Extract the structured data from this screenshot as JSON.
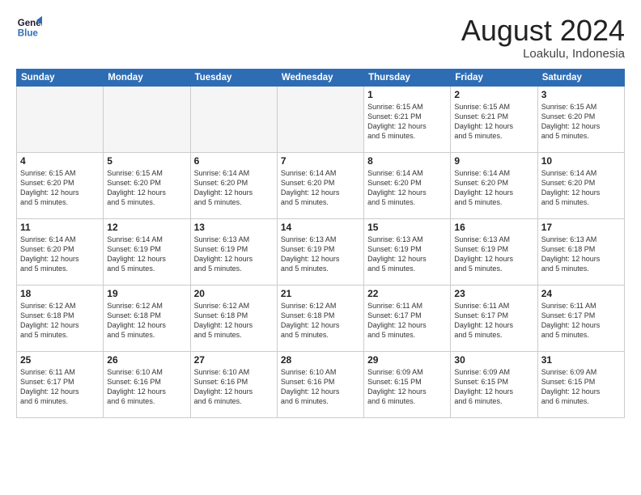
{
  "logo": {
    "line1": "General",
    "line2": "Blue"
  },
  "title": "August 2024",
  "location": "Loakulu, Indonesia",
  "days": [
    "Sunday",
    "Monday",
    "Tuesday",
    "Wednesday",
    "Thursday",
    "Friday",
    "Saturday"
  ],
  "weeks": [
    [
      {
        "day": "",
        "info": ""
      },
      {
        "day": "",
        "info": ""
      },
      {
        "day": "",
        "info": ""
      },
      {
        "day": "",
        "info": ""
      },
      {
        "day": "1",
        "info": "Sunrise: 6:15 AM\nSunset: 6:21 PM\nDaylight: 12 hours\nand 5 minutes."
      },
      {
        "day": "2",
        "info": "Sunrise: 6:15 AM\nSunset: 6:21 PM\nDaylight: 12 hours\nand 5 minutes."
      },
      {
        "day": "3",
        "info": "Sunrise: 6:15 AM\nSunset: 6:20 PM\nDaylight: 12 hours\nand 5 minutes."
      }
    ],
    [
      {
        "day": "4",
        "info": "Sunrise: 6:15 AM\nSunset: 6:20 PM\nDaylight: 12 hours\nand 5 minutes."
      },
      {
        "day": "5",
        "info": "Sunrise: 6:15 AM\nSunset: 6:20 PM\nDaylight: 12 hours\nand 5 minutes."
      },
      {
        "day": "6",
        "info": "Sunrise: 6:14 AM\nSunset: 6:20 PM\nDaylight: 12 hours\nand 5 minutes."
      },
      {
        "day": "7",
        "info": "Sunrise: 6:14 AM\nSunset: 6:20 PM\nDaylight: 12 hours\nand 5 minutes."
      },
      {
        "day": "8",
        "info": "Sunrise: 6:14 AM\nSunset: 6:20 PM\nDaylight: 12 hours\nand 5 minutes."
      },
      {
        "day": "9",
        "info": "Sunrise: 6:14 AM\nSunset: 6:20 PM\nDaylight: 12 hours\nand 5 minutes."
      },
      {
        "day": "10",
        "info": "Sunrise: 6:14 AM\nSunset: 6:20 PM\nDaylight: 12 hours\nand 5 minutes."
      }
    ],
    [
      {
        "day": "11",
        "info": "Sunrise: 6:14 AM\nSunset: 6:20 PM\nDaylight: 12 hours\nand 5 minutes."
      },
      {
        "day": "12",
        "info": "Sunrise: 6:14 AM\nSunset: 6:19 PM\nDaylight: 12 hours\nand 5 minutes."
      },
      {
        "day": "13",
        "info": "Sunrise: 6:13 AM\nSunset: 6:19 PM\nDaylight: 12 hours\nand 5 minutes."
      },
      {
        "day": "14",
        "info": "Sunrise: 6:13 AM\nSunset: 6:19 PM\nDaylight: 12 hours\nand 5 minutes."
      },
      {
        "day": "15",
        "info": "Sunrise: 6:13 AM\nSunset: 6:19 PM\nDaylight: 12 hours\nand 5 minutes."
      },
      {
        "day": "16",
        "info": "Sunrise: 6:13 AM\nSunset: 6:19 PM\nDaylight: 12 hours\nand 5 minutes."
      },
      {
        "day": "17",
        "info": "Sunrise: 6:13 AM\nSunset: 6:18 PM\nDaylight: 12 hours\nand 5 minutes."
      }
    ],
    [
      {
        "day": "18",
        "info": "Sunrise: 6:12 AM\nSunset: 6:18 PM\nDaylight: 12 hours\nand 5 minutes."
      },
      {
        "day": "19",
        "info": "Sunrise: 6:12 AM\nSunset: 6:18 PM\nDaylight: 12 hours\nand 5 minutes."
      },
      {
        "day": "20",
        "info": "Sunrise: 6:12 AM\nSunset: 6:18 PM\nDaylight: 12 hours\nand 5 minutes."
      },
      {
        "day": "21",
        "info": "Sunrise: 6:12 AM\nSunset: 6:18 PM\nDaylight: 12 hours\nand 5 minutes."
      },
      {
        "day": "22",
        "info": "Sunrise: 6:11 AM\nSunset: 6:17 PM\nDaylight: 12 hours\nand 5 minutes."
      },
      {
        "day": "23",
        "info": "Sunrise: 6:11 AM\nSunset: 6:17 PM\nDaylight: 12 hours\nand 5 minutes."
      },
      {
        "day": "24",
        "info": "Sunrise: 6:11 AM\nSunset: 6:17 PM\nDaylight: 12 hours\nand 5 minutes."
      }
    ],
    [
      {
        "day": "25",
        "info": "Sunrise: 6:11 AM\nSunset: 6:17 PM\nDaylight: 12 hours\nand 6 minutes."
      },
      {
        "day": "26",
        "info": "Sunrise: 6:10 AM\nSunset: 6:16 PM\nDaylight: 12 hours\nand 6 minutes."
      },
      {
        "day": "27",
        "info": "Sunrise: 6:10 AM\nSunset: 6:16 PM\nDaylight: 12 hours\nand 6 minutes."
      },
      {
        "day": "28",
        "info": "Sunrise: 6:10 AM\nSunset: 6:16 PM\nDaylight: 12 hours\nand 6 minutes."
      },
      {
        "day": "29",
        "info": "Sunrise: 6:09 AM\nSunset: 6:15 PM\nDaylight: 12 hours\nand 6 minutes."
      },
      {
        "day": "30",
        "info": "Sunrise: 6:09 AM\nSunset: 6:15 PM\nDaylight: 12 hours\nand 6 minutes."
      },
      {
        "day": "31",
        "info": "Sunrise: 6:09 AM\nSunset: 6:15 PM\nDaylight: 12 hours\nand 6 minutes."
      }
    ]
  ]
}
